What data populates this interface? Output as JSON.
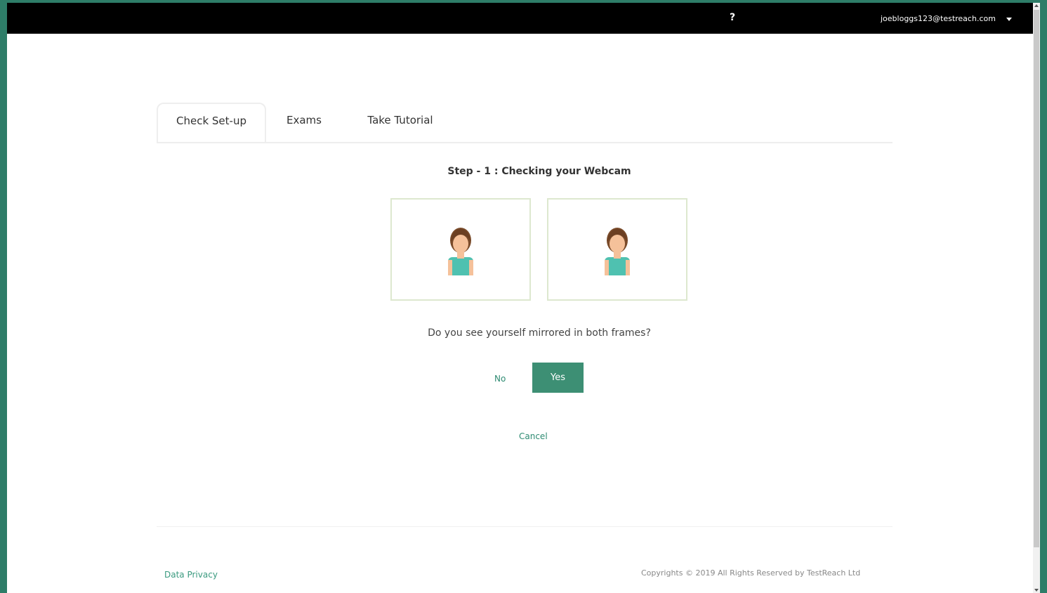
{
  "header": {
    "help_label": "?",
    "user_email": "joebloggs123@testreach.com"
  },
  "tabs": [
    {
      "label": "Check Set-up",
      "active": true
    },
    {
      "label": "Exams",
      "active": false
    },
    {
      "label": "Take Tutorial",
      "active": false
    }
  ],
  "main": {
    "step_title": "Step - 1 : Checking your Webcam",
    "question": "Do you see yourself mirrored in both frames?",
    "no_label": "No",
    "yes_label": "Yes",
    "cancel_label": "Cancel",
    "camera_frames": [
      {
        "icon": "person-avatar-icon"
      },
      {
        "icon": "person-avatar-icon"
      }
    ]
  },
  "footer": {
    "data_privacy": "Data Privacy",
    "copyright": "Copyrights © 2019 All Rights Reserved by TestReach Ltd"
  },
  "colors": {
    "accent": "#3d8f74",
    "link": "#2e8b72",
    "topbar": "#000000",
    "border_frame": "#dde8cf"
  }
}
